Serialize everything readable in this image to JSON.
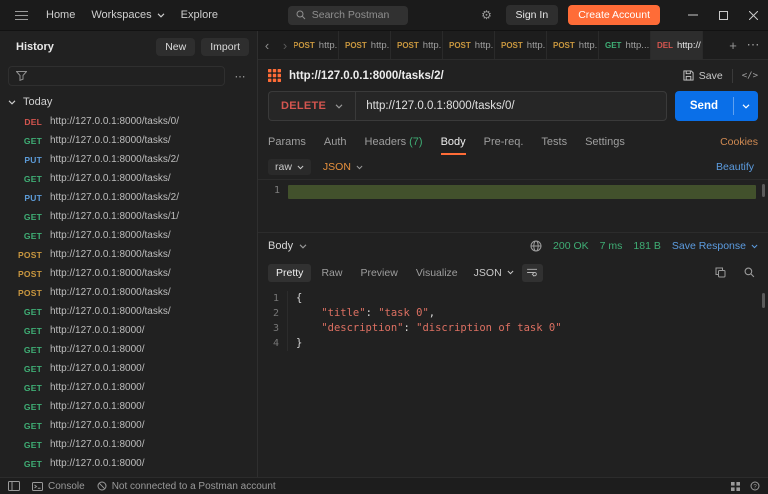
{
  "colors": {
    "accent_orange": "#ff6c37",
    "send_blue": "#0a6fe8",
    "status_green": "#3fae75",
    "method_get": "#3fae75",
    "method_post": "#c9973f",
    "method_put": "#5c9bd8",
    "method_delete": "#d4554f"
  },
  "topbar": {
    "home_label": "Home",
    "workspaces_label": "Workspaces",
    "explore_label": "Explore",
    "search_placeholder": "Search Postman",
    "sign_in_label": "Sign In",
    "create_account_label": "Create Account"
  },
  "sidebar": {
    "title": "History",
    "new_label": "New",
    "import_label": "Import",
    "group_label": "Today",
    "items": [
      {
        "method": "DEL",
        "url": "http://127.0.0.1:8000/tasks/0/"
      },
      {
        "method": "GET",
        "url": "http://127.0.0.1:8000/tasks/"
      },
      {
        "method": "PUT",
        "url": "http://127.0.0.1:8000/tasks/2/"
      },
      {
        "method": "GET",
        "url": "http://127.0.0.1:8000/tasks/"
      },
      {
        "method": "PUT",
        "url": "http://127.0.0.1:8000/tasks/2/"
      },
      {
        "method": "GET",
        "url": "http://127.0.0.1:8000/tasks/1/"
      },
      {
        "method": "GET",
        "url": "http://127.0.0.1:8000/tasks/"
      },
      {
        "method": "POST",
        "url": "http://127.0.0.1:8000/tasks/"
      },
      {
        "method": "POST",
        "url": "http://127.0.0.1:8000/tasks/"
      },
      {
        "method": "POST",
        "url": "http://127.0.0.1:8000/tasks/"
      },
      {
        "method": "GET",
        "url": "http://127.0.0.1:8000/tasks/"
      },
      {
        "method": "GET",
        "url": "http://127.0.0.1:8000/"
      },
      {
        "method": "GET",
        "url": "http://127.0.0.1:8000/"
      },
      {
        "method": "GET",
        "url": "http://127.0.0.1:8000/"
      },
      {
        "method": "GET",
        "url": "http://127.0.0.1:8000/"
      },
      {
        "method": "GET",
        "url": "http://127.0.0.1:8000/"
      },
      {
        "method": "GET",
        "url": "http://127.0.0.1:8000/"
      },
      {
        "method": "GET",
        "url": "http://127.0.0.1:8000/"
      },
      {
        "method": "GET",
        "url": "http://127.0.0.1:8000/"
      }
    ]
  },
  "tabbar": {
    "tabs": [
      {
        "method": "POST",
        "label": "http..."
      },
      {
        "method": "POST",
        "label": "http..."
      },
      {
        "method": "POST",
        "label": "http..."
      },
      {
        "method": "POST",
        "label": "http..."
      },
      {
        "method": "POST",
        "label": "http..."
      },
      {
        "method": "POST",
        "label": "http..."
      },
      {
        "method": "GET",
        "label": "http..."
      },
      {
        "method": "DEL",
        "label": "http://",
        "active": true
      }
    ]
  },
  "request": {
    "title": "http://127.0.0.1:8000/tasks/2/",
    "save_label": "Save",
    "method": "DELETE",
    "url": "http://127.0.0.1:8000/tasks/0/",
    "send_label": "Send",
    "tabs": [
      {
        "label": "Params"
      },
      {
        "label": "Auth"
      },
      {
        "label": "Headers",
        "badge": "(7)"
      },
      {
        "label": "Body",
        "active": true
      },
      {
        "label": "Pre-req."
      },
      {
        "label": "Tests"
      },
      {
        "label": "Settings"
      }
    ],
    "cookies_label": "Cookies",
    "body_format": "raw",
    "body_language": "JSON",
    "beautify_label": "Beautify",
    "editor_line_number": "1"
  },
  "response": {
    "body_label": "Body",
    "status": "200 OK",
    "time": "7 ms",
    "size": "181 B",
    "save_response_label": "Save Response",
    "tabs": [
      {
        "label": "Pretty",
        "active": true
      },
      {
        "label": "Raw"
      },
      {
        "label": "Preview"
      },
      {
        "label": "Visualize"
      }
    ],
    "language": "JSON",
    "lines": [
      {
        "num": "1",
        "segments": [
          {
            "t": "{",
            "c": "p"
          }
        ]
      },
      {
        "num": "2",
        "segments": [
          {
            "t": "    ",
            "c": "p"
          },
          {
            "t": "\"title\"",
            "c": "s"
          },
          {
            "t": ": ",
            "c": "p"
          },
          {
            "t": "\"task 0\"",
            "c": "s"
          },
          {
            "t": ",",
            "c": "p"
          }
        ]
      },
      {
        "num": "3",
        "segments": [
          {
            "t": "    ",
            "c": "p"
          },
          {
            "t": "\"description\"",
            "c": "s"
          },
          {
            "t": ": ",
            "c": "p"
          },
          {
            "t": "\"discription of task 0\"",
            "c": "s"
          }
        ]
      },
      {
        "num": "4",
        "segments": [
          {
            "t": "}",
            "c": "p"
          }
        ]
      }
    ]
  },
  "statusbar": {
    "console_label": "Console",
    "connection_status": "Not connected to a Postman account"
  }
}
